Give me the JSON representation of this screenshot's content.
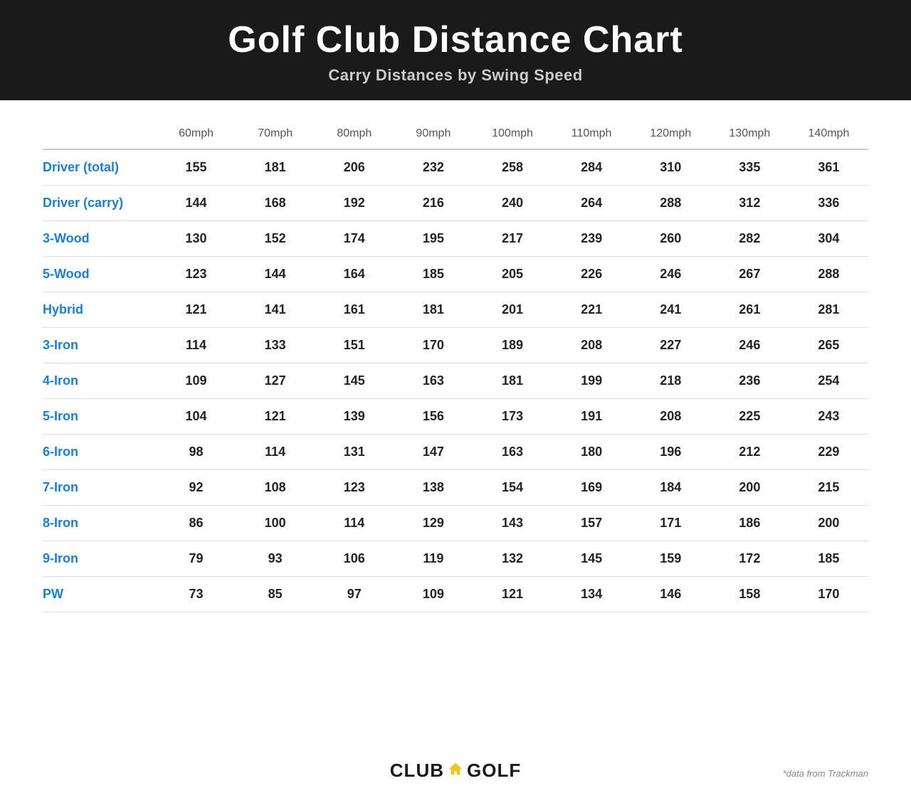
{
  "header": {
    "title": "Golf Club Distance Chart",
    "subtitle": "Carry Distances by Swing Speed"
  },
  "table": {
    "columns": [
      "",
      "60mph",
      "70mph",
      "80mph",
      "90mph",
      "100mph",
      "110mph",
      "120mph",
      "130mph",
      "140mph"
    ],
    "rows": [
      {
        "club": "Driver (total)",
        "values": [
          "155",
          "181",
          "206",
          "232",
          "258",
          "284",
          "310",
          "335",
          "361"
        ]
      },
      {
        "club": "Driver (carry)",
        "values": [
          "144",
          "168",
          "192",
          "216",
          "240",
          "264",
          "288",
          "312",
          "336"
        ]
      },
      {
        "club": "3-Wood",
        "values": [
          "130",
          "152",
          "174",
          "195",
          "217",
          "239",
          "260",
          "282",
          "304"
        ]
      },
      {
        "club": "5-Wood",
        "values": [
          "123",
          "144",
          "164",
          "185",
          "205",
          "226",
          "246",
          "267",
          "288"
        ]
      },
      {
        "club": "Hybrid",
        "values": [
          "121",
          "141",
          "161",
          "181",
          "201",
          "221",
          "241",
          "261",
          "281"
        ]
      },
      {
        "club": "3-Iron",
        "values": [
          "114",
          "133",
          "151",
          "170",
          "189",
          "208",
          "227",
          "246",
          "265"
        ]
      },
      {
        "club": "4-Iron",
        "values": [
          "109",
          "127",
          "145",
          "163",
          "181",
          "199",
          "218",
          "236",
          "254"
        ]
      },
      {
        "club": "5-Iron",
        "values": [
          "104",
          "121",
          "139",
          "156",
          "173",
          "191",
          "208",
          "225",
          "243"
        ]
      },
      {
        "club": "6-Iron",
        "values": [
          "98",
          "114",
          "131",
          "147",
          "163",
          "180",
          "196",
          "212",
          "229"
        ]
      },
      {
        "club": "7-Iron",
        "values": [
          "92",
          "108",
          "123",
          "138",
          "154",
          "169",
          "184",
          "200",
          "215"
        ]
      },
      {
        "club": "8-Iron",
        "values": [
          "86",
          "100",
          "114",
          "129",
          "143",
          "157",
          "171",
          "186",
          "200"
        ]
      },
      {
        "club": "9-Iron",
        "values": [
          "79",
          "93",
          "106",
          "119",
          "132",
          "145",
          "159",
          "172",
          "185"
        ]
      },
      {
        "club": "PW",
        "values": [
          "73",
          "85",
          "97",
          "109",
          "121",
          "134",
          "146",
          "158",
          "170"
        ]
      }
    ]
  },
  "footer": {
    "attribution": "*data from Trackman",
    "brand": {
      "club": "CLUB",
      "up": "up",
      "golf": "GOLF"
    }
  }
}
